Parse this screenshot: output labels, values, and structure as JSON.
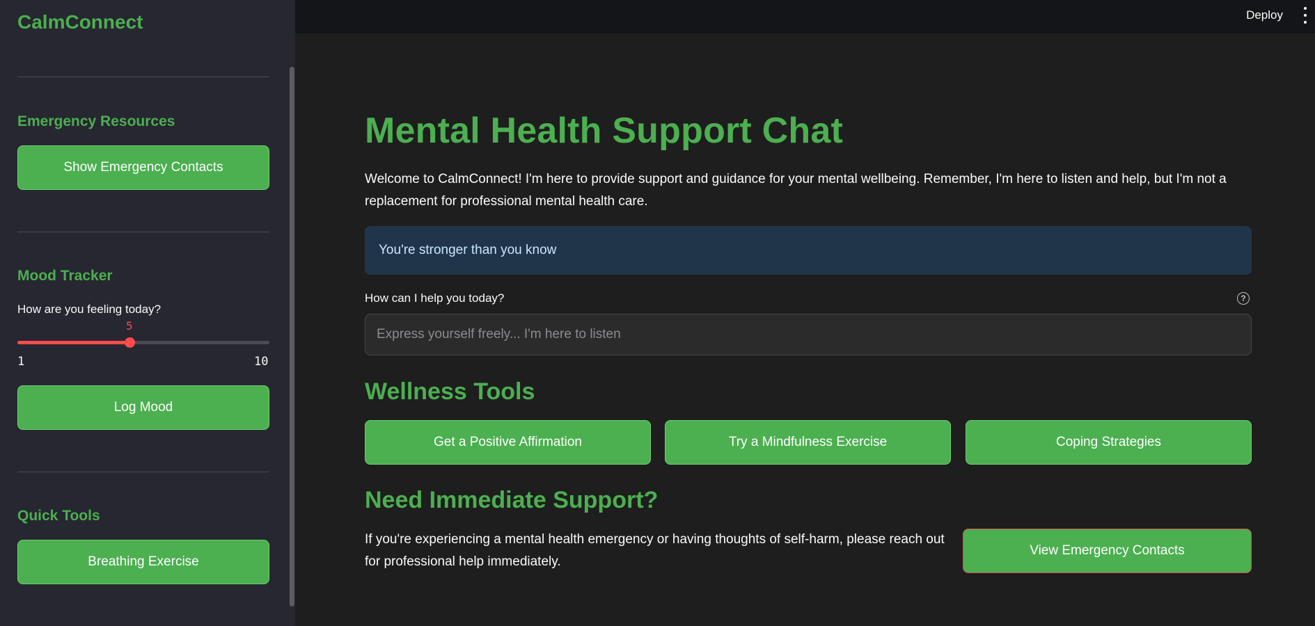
{
  "app": {
    "name": "CalmConnect"
  },
  "topbar": {
    "deploy_label": "Deploy"
  },
  "sidebar": {
    "emergency": {
      "heading": "Emergency Resources",
      "button_label": "Show Emergency Contacts"
    },
    "mood": {
      "heading": "Mood Tracker",
      "slider_label": "How are you feeling today?",
      "value": 5,
      "min": 1,
      "max": 10,
      "button_label": "Log Mood"
    },
    "quick_tools": {
      "heading": "Quick Tools",
      "button_label": "Breathing Exercise"
    }
  },
  "main": {
    "title": "Mental Health Support Chat",
    "intro": "Welcome to CalmConnect! I'm here to provide support and guidance for your mental wellbeing. Remember, I'm here to listen and help, but I'm not a replacement for professional mental health care.",
    "affirmation": "You're stronger than you know",
    "chat": {
      "label": "How can I help you today?",
      "placeholder": "Express yourself freely... I'm here to listen",
      "value": ""
    },
    "wellness": {
      "heading": "Wellness Tools",
      "buttons": [
        "Get a Positive Affirmation",
        "Try a Mindfulness Exercise",
        "Coping Strategies"
      ]
    },
    "support": {
      "heading": "Need Immediate Support?",
      "text": "If you're experiencing a mental health emergency or having thoughts of self-harm, please reach out for professional help immediately.",
      "button_label": "View Emergency Contacts"
    }
  },
  "colors": {
    "accent": "#4caf50",
    "slider": "#ff4b4b",
    "info_bg": "#21354a"
  }
}
